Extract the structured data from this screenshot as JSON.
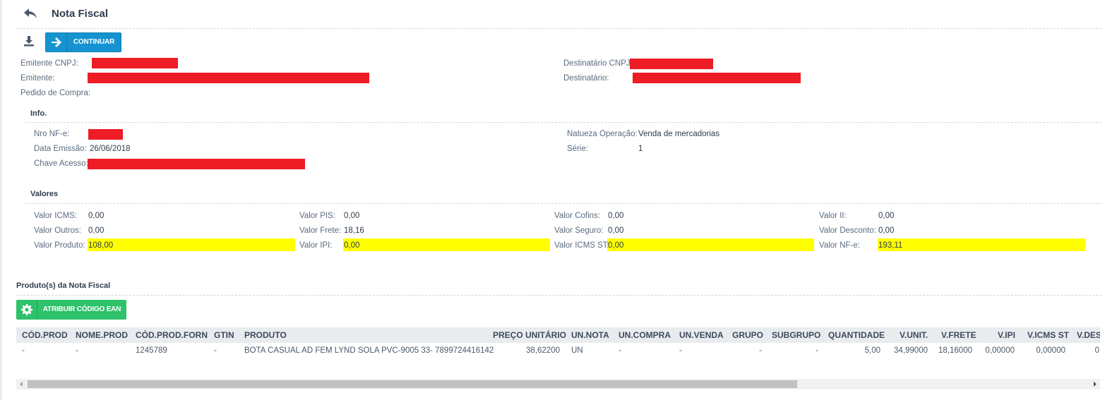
{
  "header": {
    "title": "Nota Fiscal"
  },
  "toolbar": {
    "continue_label": "CONTINUAR"
  },
  "emitter": {
    "cnpj_label": "Emitente CNPJ:",
    "name_label": "Emitente:",
    "po_label": "Pedido de Compra:",
    "dest_cnpj_label": "Destinatário CNPJ:",
    "dest_label": "Destinatário:"
  },
  "info": {
    "title": "Info.",
    "nro_label": "Nro NF-e:",
    "data_label": "Data Emissão:",
    "data_value": "26/06/2018",
    "chave_label": "Chave Acesso:",
    "natureza_label": "Natueza Operação:",
    "natureza_value": "Venda de mercadorias",
    "serie_label": "Série:",
    "serie_value": "1"
  },
  "valores": {
    "title": "Valores",
    "icms": {
      "label": "Valor ICMS:",
      "value": "0,00"
    },
    "outros": {
      "label": "Valor Outros:",
      "value": "0,00"
    },
    "produto": {
      "label": "Valor Produto:",
      "value": "108,00"
    },
    "pis": {
      "label": "Valor PIS:",
      "value": "0,00"
    },
    "frete": {
      "label": "Valor Frete:",
      "value": "18,16"
    },
    "ipi": {
      "label": "Valor IPI:",
      "value": "0,00"
    },
    "cofins": {
      "label": "Valor Cofins:",
      "value": "0,00"
    },
    "seguro": {
      "label": "Valor Seguro:",
      "value": "0,00"
    },
    "icms_st": {
      "label": "Valor ICMS ST:",
      "value": "0,00"
    },
    "ii": {
      "label": "Valor II:",
      "value": "0,00"
    },
    "desconto": {
      "label": "Valor Desconto:",
      "value": "0,00"
    },
    "nfe": {
      "label": "Valor NF-e:",
      "value": "193,11"
    },
    "highlight_color": "#ffff00"
  },
  "produtos": {
    "title": "Produto(s) da Nota Fiscal",
    "ean_button_label": "ATRIBUIR CÓDIGO EAN",
    "columns": [
      "CÓD.PROD",
      "NOME.PROD",
      "CÓD.PROD.FORN",
      "GTIN",
      "PRODUTO",
      "PREÇO UNITÁRIO",
      "UN.NOTA",
      "UN.COMPRA",
      "UN.VENDA",
      "GRUPO",
      "SUBGRUPO",
      "QUANTIDADE",
      "V.UNIT.",
      "V.FRETE",
      "V.IPI",
      "V.ICMS ST",
      "V.DESC"
    ],
    "rows": [
      [
        "-",
        "-",
        "1245789",
        "-",
        "BOTA CASUAL AD FEM LYND SOLA PVC-9005 33- 7899724416142",
        "38,62200",
        "UN",
        "-",
        "-",
        "-",
        "-",
        "5,00",
        "34,99000",
        "18,16000",
        "0,00000",
        "0,00000",
        "0"
      ]
    ]
  },
  "colors": {
    "primary_button": "#1593d0",
    "success_button": "#2ec26a",
    "redaction": "#ee1c25",
    "table_header_bg": "#e9ecef"
  }
}
